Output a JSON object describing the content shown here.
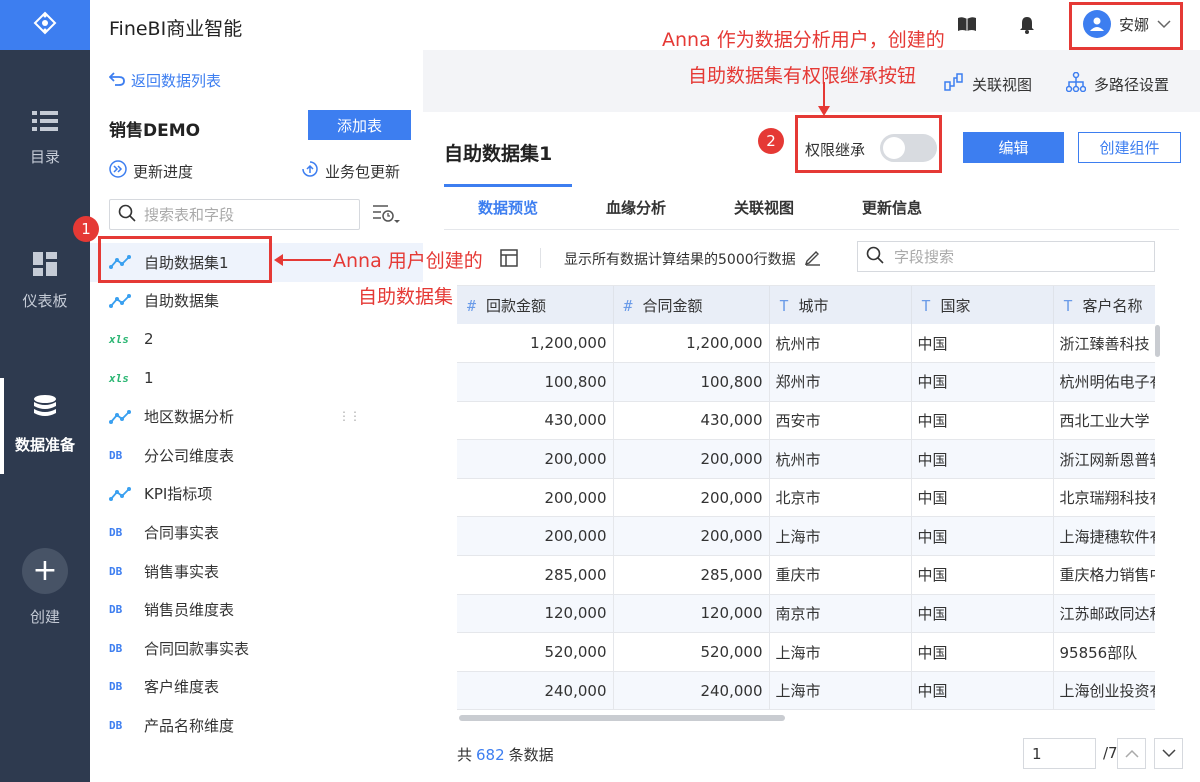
{
  "rail": {
    "items": [
      {
        "label": "目录"
      },
      {
        "label": "仪表板"
      },
      {
        "label": "数据准备"
      },
      {
        "label": "创建"
      }
    ]
  },
  "app": {
    "title": "FineBI商业智能"
  },
  "left": {
    "back_label": "返回数据列表",
    "package_title": "销售DEMO",
    "add_table_label": "添加表",
    "update_progress_label": "更新进度",
    "package_update_label": "业务包更新",
    "search_placeholder": "搜索表和字段",
    "tree": [
      {
        "type": "self",
        "label": "自助数据集1"
      },
      {
        "type": "self",
        "label": "自助数据集"
      },
      {
        "type": "xls",
        "label": "2"
      },
      {
        "type": "xls",
        "label": "1"
      },
      {
        "type": "self",
        "label": "地区数据分析"
      },
      {
        "type": "db",
        "label": "分公司维度表"
      },
      {
        "type": "self",
        "label": "KPI指标项"
      },
      {
        "type": "db",
        "label": "合同事实表"
      },
      {
        "type": "db",
        "label": "销售事实表"
      },
      {
        "type": "db",
        "label": "销售员维度表"
      },
      {
        "type": "db",
        "label": "合同回款事实表"
      },
      {
        "type": "db",
        "label": "客户维度表"
      },
      {
        "type": "db",
        "label": "产品名称维度"
      }
    ]
  },
  "header": {
    "user_name": "安娜",
    "related_view_label": "关联视图",
    "multipath_label": "多路径设置"
  },
  "dataset": {
    "title": "自助数据集1",
    "permission_label": "权限继承",
    "edit_label": "编辑",
    "create_component_label": "创建组件",
    "tabs": [
      {
        "label": "数据预览"
      },
      {
        "label": "血缘分析"
      },
      {
        "label": "关联视图"
      },
      {
        "label": "更新信息"
      }
    ],
    "preview_info": "显示所有数据计算结果的5000行数据",
    "field_search_placeholder": "字段搜索",
    "columns": [
      {
        "type": "#",
        "name": "回款金额"
      },
      {
        "type": "#",
        "name": "合同金额"
      },
      {
        "type": "T",
        "name": "城市"
      },
      {
        "type": "T",
        "name": "国家"
      },
      {
        "type": "T",
        "name": "客户名称"
      }
    ],
    "rows": [
      [
        "1,200,000",
        "1,200,000",
        "杭州市",
        "中国",
        "浙江臻善科技"
      ],
      [
        "100,800",
        "100,800",
        "郑州市",
        "中国",
        "杭州明佑电子有"
      ],
      [
        "430,000",
        "430,000",
        "西安市",
        "中国",
        "西北工业大学"
      ],
      [
        "200,000",
        "200,000",
        "杭州市",
        "中国",
        "浙江网新恩普软"
      ],
      [
        "200,000",
        "200,000",
        "北京市",
        "中国",
        "北京瑞翔科技有"
      ],
      [
        "200,000",
        "200,000",
        "上海市",
        "中国",
        "上海捷穗软件有"
      ],
      [
        "285,000",
        "285,000",
        "重庆市",
        "中国",
        "重庆格力销售中"
      ],
      [
        "120,000",
        "120,000",
        "南京市",
        "中国",
        "江苏邮政同达科"
      ],
      [
        "520,000",
        "520,000",
        "上海市",
        "中国",
        "95856部队"
      ],
      [
        "240,000",
        "240,000",
        "上海市",
        "中国",
        "上海创业投资有"
      ]
    ],
    "footer": {
      "total_prefix": "共",
      "total_count": "682",
      "total_suffix": "条数据",
      "page_value": "1",
      "page_total": "/7"
    }
  },
  "annotations": {
    "badge1": "1",
    "badge2": "2",
    "note1_line1": "Anna 用户创建的",
    "note1_line2": "自助数据集",
    "note2_line1": "Anna 作为数据分析用户，创建的",
    "note2_line2": "自助数据集有权限继承按钮"
  },
  "colors": {
    "accent": "#3d7ef0",
    "rail_bg": "#2e3a4f",
    "annotation": "#e53935"
  }
}
